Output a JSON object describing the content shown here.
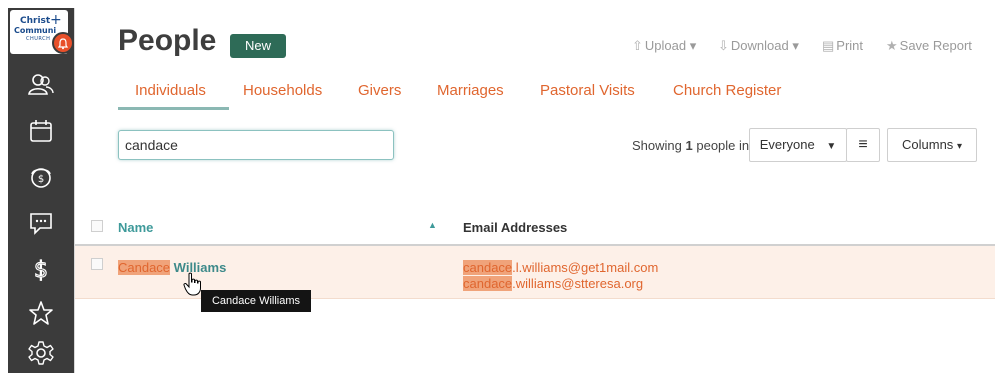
{
  "app": {
    "logo": {
      "line1": "Christ",
      "line2": "Communi",
      "line3": "CHURCH"
    },
    "notification_icon": "bell-icon",
    "accent": "#e0662f",
    "teal": "#3e9a9a"
  },
  "sidebar": {
    "items": [
      {
        "name": "people",
        "icon": "people-icon"
      },
      {
        "name": "calendar",
        "icon": "calendar-icon"
      },
      {
        "name": "giving",
        "icon": "giving-icon"
      },
      {
        "name": "messages",
        "icon": "chat-icon"
      },
      {
        "name": "finance",
        "icon": "dollar-icon"
      },
      {
        "name": "favorites",
        "icon": "star-icon"
      },
      {
        "name": "settings",
        "icon": "gear-icon"
      }
    ]
  },
  "header": {
    "title": "People",
    "new_label": "New",
    "upload_label": "Upload",
    "download_label": "Download",
    "print_label": "Print",
    "save_report_label": "Save Report"
  },
  "tabs": [
    {
      "label": "Individuals",
      "active": true
    },
    {
      "label": "Households"
    },
    {
      "label": "Givers"
    },
    {
      "label": "Marriages"
    },
    {
      "label": "Pastoral Visits"
    },
    {
      "label": "Church Register"
    }
  ],
  "search": {
    "value": "candace"
  },
  "results": {
    "showing_prefix": "Showing",
    "count": "1",
    "showing_suffix": "people in",
    "filter_value": "Everyone",
    "columns_label": "Columns"
  },
  "table": {
    "columns": [
      "Name",
      "Email Addresses"
    ],
    "rows": [
      {
        "name_match": "Candace",
        "name_rest": "Williams",
        "emails": [
          {
            "match": "candace",
            "rest": ".l.williams@get1mail.com"
          },
          {
            "match": "candace",
            "rest": ".williams@stteresa.org"
          }
        ]
      }
    ]
  },
  "tooltip": "Candace Williams"
}
